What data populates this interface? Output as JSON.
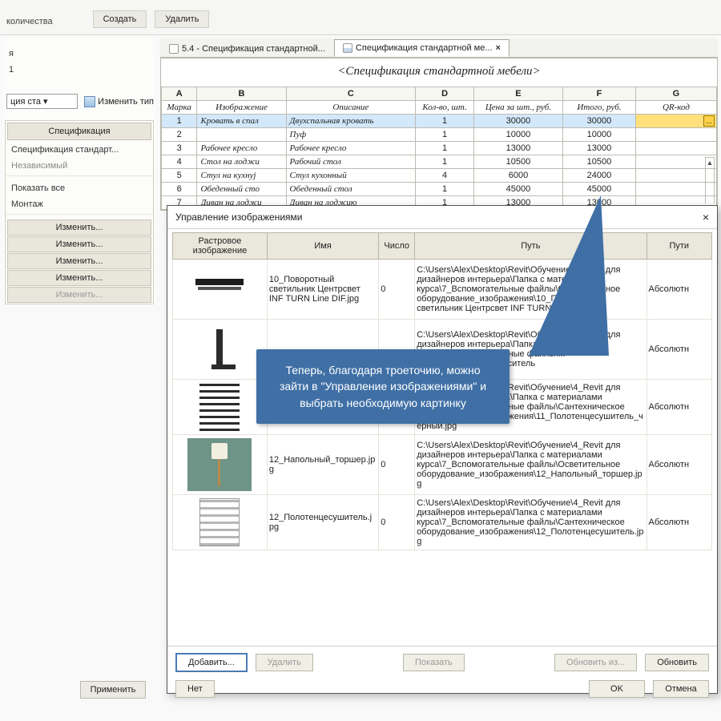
{
  "toolbar": {
    "quantity_label": "количества",
    "create_label": "Создать",
    "delete_label": "Удалить"
  },
  "left": {
    "line1": "",
    "line2": "1",
    "tree_item": "ция ста ▾",
    "edit_type": "Изменить тип",
    "spec_header": "Спецификация",
    "spec_name": "Спецификация стандарт...",
    "independent": "Независимый",
    "show_all": "Показать все",
    "montage": "Монтаж",
    "edit_labels": [
      "Изменить...",
      "Изменить...",
      "Изменить...",
      "Изменить...",
      "Изменить..."
    ],
    "apply": "Применить"
  },
  "tabs": {
    "tab1": "5.4 - Спецификация стандартной...",
    "tab2": "Спецификация стандартной ме...",
    "close": "×"
  },
  "schedule": {
    "title": "<Спецификация стандартной мебели>",
    "letters": [
      "A",
      "B",
      "C",
      "D",
      "E",
      "F",
      "G"
    ],
    "headers": [
      "Марка",
      "Изображение",
      "Описание",
      "Кол-во, шт.",
      "Цена за шт., руб.",
      "Итого, руб.",
      "QR-код"
    ],
    "rows": [
      [
        "1",
        "Кровать в спал",
        "Двухспальная кровать",
        "1",
        "30000",
        "30000",
        ""
      ],
      [
        "2",
        "",
        "Пуф",
        "1",
        "10000",
        "10000",
        ""
      ],
      [
        "3",
        "Рабочее кресло",
        "Рабочее кресло",
        "1",
        "13000",
        "13000",
        ""
      ],
      [
        "4",
        "Стол на лоджи",
        "Рабочий стол",
        "1",
        "10500",
        "10500",
        ""
      ],
      [
        "5",
        "Стул на кухнуј",
        "Стул кухонный",
        "4",
        "6000",
        "24000",
        ""
      ],
      [
        "6",
        "Обеденный сто",
        "Обеденный стол",
        "1",
        "45000",
        "45000",
        ""
      ],
      [
        "7",
        "Диван на лоджи",
        "Диван на лоджию",
        "1",
        "13000",
        "13000",
        ""
      ]
    ],
    "ellipsis": "..."
  },
  "dialog": {
    "title": "Управление изображениями",
    "close": "×",
    "headers": [
      "Растровое изображение",
      "Имя",
      "Число",
      "Путь",
      "Пути"
    ],
    "rows": [
      {
        "thumb": "lamp",
        "name": "10_Поворотный светильник Центрсвет INF TURN Line DIF.jpg",
        "count": "0",
        "path": "C:\\Users\\Alex\\Desktop\\Revit\\Обучение\\4_Revit для дизайнеров интерьера\\Папка с материалами курса\\7_Вспомогательные файлы\\Осветительное оборудование_изображения\\10_Поворотный светильник Центрсвет INF TURN Line DIF.jpg",
        "ptype": "Абсолютн"
      },
      {
        "thumb": "faucet",
        "name": "",
        "count": "",
        "path": "C:\\Users\\Alex\\Desktop\\Revit\\Обучение\\4_Revit для дизайнеров интерьера\\Папка с материалами курса\\7_Вспомогательные файлы\\... \\изображения\\10_Смеситель",
        "ptype": "Абсолютн"
      },
      {
        "thumb": "radiator",
        "name": "",
        "count": "",
        "path": "C:\\Users\\Alex\\Desktop\\Revit\\Обучение\\4_Revit для дизайнеров интерьера\\Папка с материалами курса\\7_Вспомогательные файлы\\Сантехническое оборудование_изображения\\11_Полотенцесушитель_черный.jpg",
        "ptype": "Абсолютн"
      },
      {
        "thumb": "floorlamp",
        "name": "12_Напольный_торшер.jpg",
        "count": "0",
        "path": "C:\\Users\\Alex\\Desktop\\Revit\\Обучение\\4_Revit для дизайнеров интерьера\\Папка с материалами курса\\7_Вспомогательные файлы\\Осветительное оборудование_изображения\\12_Напольный_торшер.jpg",
        "ptype": "Абсолютн"
      },
      {
        "thumb": "towel",
        "name": "12_Полотенцесушитель.jpg",
        "count": "0",
        "path": "C:\\Users\\Alex\\Desktop\\Revit\\Обучение\\4_Revit для дизайнеров интерьера\\Папка с материалами курса\\7_Вспомогательные файлы\\Сантехническое оборудование_изображения\\12_Полотенцесушитель.jpg",
        "ptype": "Абсолютн"
      }
    ],
    "footer": {
      "add": "Добавить...",
      "del": "Удалить",
      "show": "Показать",
      "refresh_from": "Обновить из...",
      "refresh": "Обновить",
      "no": "Нет",
      "ok": "OK",
      "cancel": "Отмена"
    }
  },
  "callout": {
    "text": "Теперь, благодаря троеточию, можно зайти в \"Управление изображениями\" и выбрать необходимую картинку"
  }
}
